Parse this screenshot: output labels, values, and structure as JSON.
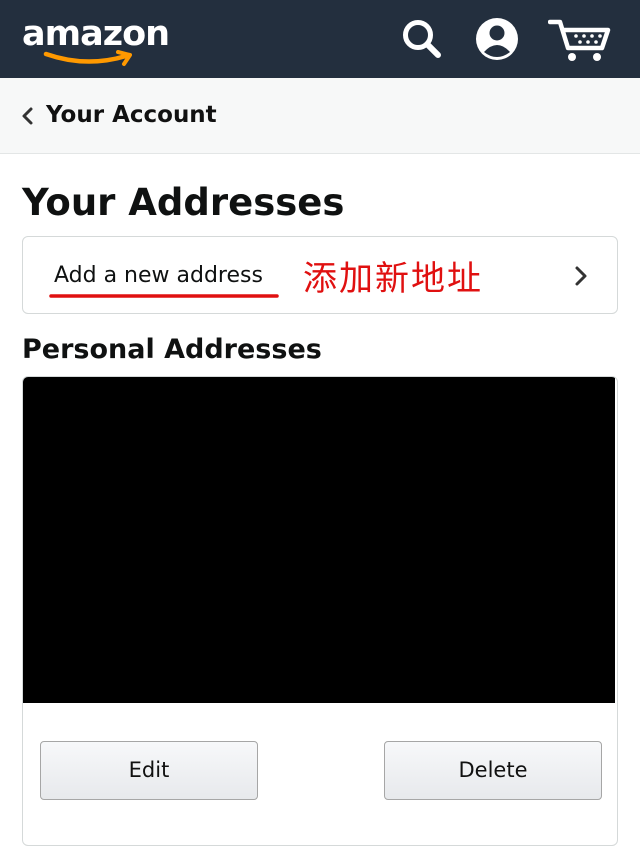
{
  "header": {
    "logo_text": "amazon",
    "brand_color": "#232f3e",
    "smile_color": "#ff9900",
    "icons": [
      "search-icon",
      "account-icon",
      "cart-icon"
    ]
  },
  "subnav": {
    "back_label": "Your Account"
  },
  "page": {
    "title": "Your Addresses"
  },
  "add_address": {
    "label": "Add a new address",
    "annotation": "添加新地址",
    "annotation_color": "#e01010"
  },
  "personal": {
    "section_title": "Personal Addresses",
    "edit_label": "Edit",
    "delete_label": "Delete"
  }
}
